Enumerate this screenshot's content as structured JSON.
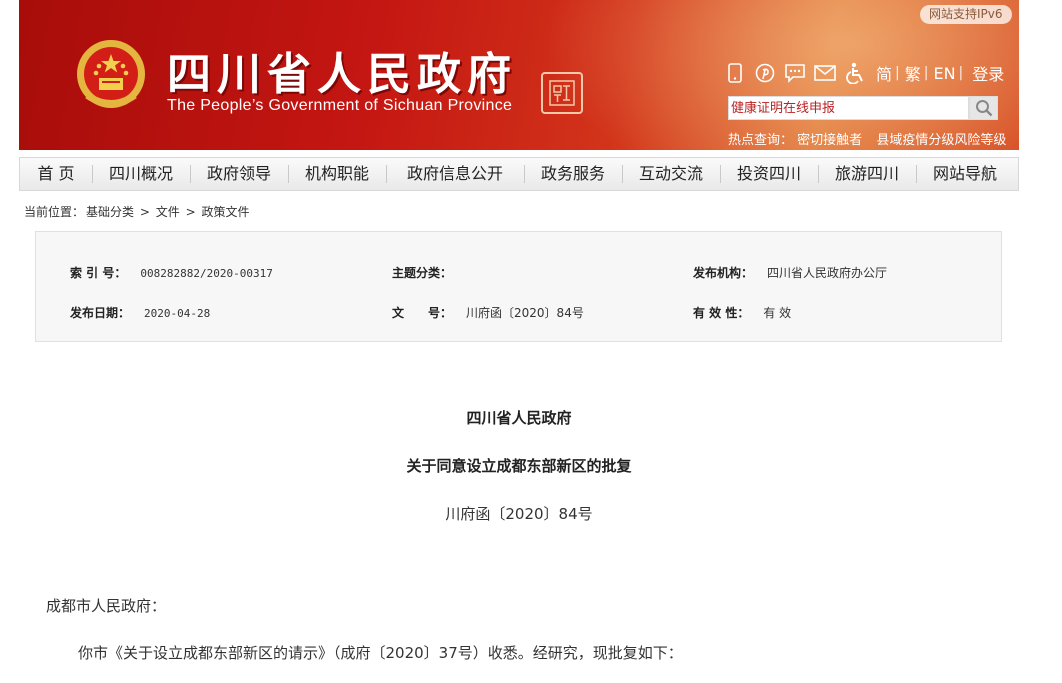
{
  "header": {
    "title": "四川省人民政府",
    "subtitle": "The People’s Government of Sichuan Province",
    "seal_text": "中国四川",
    "ipv6_label": "网站支持IPv6",
    "icons": [
      "mobile-icon",
      "pinterest-icon",
      "chat-icon",
      "mail-icon",
      "accessibility-icon"
    ],
    "lang_simplified": "简",
    "lang_traditional": "繁",
    "lang_en": "EN",
    "login": "登录",
    "search_placeholder": "健康证明在线申报",
    "hot_label": "热点查询：",
    "hot_links": [
      "密切接触者",
      "县域疫情分级风险等级"
    ]
  },
  "nav": [
    "首 页",
    "四川概况",
    "政府领导",
    "机构职能",
    "政府信息公开",
    "政务服务",
    "互动交流",
    "投资四川",
    "旅游四川",
    "网站导航"
  ],
  "breadcrumb": {
    "label": "当前位置：",
    "items": [
      "基础分类",
      "文件",
      "政策文件"
    ],
    "sep": ">"
  },
  "info": {
    "index_label": "索 引 号：",
    "index_value": "008282882/2020-00317",
    "topic_label": "主题分类：",
    "topic_value": "",
    "org_label": "发布机构：",
    "org_value": "四川省人民政府办公厅",
    "date_label": "发布日期：",
    "date_value": "2020-04-28",
    "docno_label": "文　　号：",
    "docno_value": "川府函〔2020〕84号",
    "valid_label": "有 效 性：",
    "valid_value": "有 效"
  },
  "document": {
    "issuer": "四川省人民政府",
    "title": "关于同意设立成都东部新区的批复",
    "number": "川府函〔2020〕84号",
    "salutation": "成都市人民政府：",
    "paragraph": "你市《关于设立成都东部新区的请示》（成府〔2020〕37号）收悉。经研究，现批复如下："
  },
  "colors": {
    "banner_red": "#c41612",
    "banner_orange": "#e07a3e",
    "nav_bg": "#eeeeee",
    "info_bg": "#f7f7f7"
  }
}
